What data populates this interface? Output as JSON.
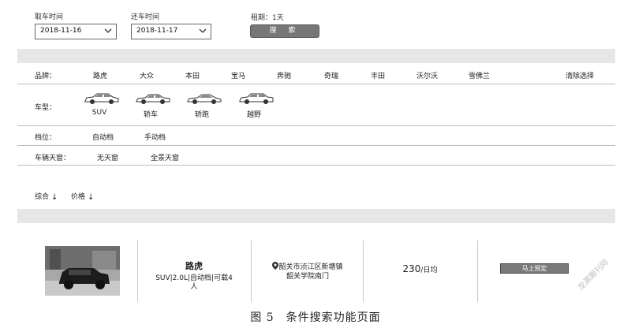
{
  "search": {
    "pickup_label": "取车时间",
    "pickup_value": "2018-11-16",
    "return_label": "还车时间",
    "return_value": "2018-11-17",
    "rental_period": "租期：1天",
    "search_button": "搜 索"
  },
  "filters": {
    "brand": {
      "label": "品牌：",
      "options": [
        "路虎",
        "大众",
        "本田",
        "宝马",
        "奔驰",
        "奇瑞",
        "丰田",
        "沃尔沃",
        "雪佛兰"
      ],
      "clear": "清除选择"
    },
    "car_type": {
      "label": "车型：",
      "options": [
        "SUV",
        "轿车",
        "轿跑",
        "越野"
      ]
    },
    "gear": {
      "label": "档位：",
      "options": [
        "自动档",
        "手动档"
      ]
    },
    "sunroof": {
      "label": "车辆天窗：",
      "options": [
        "无天窗",
        "全景天窗"
      ]
    }
  },
  "sort": {
    "overall": "综合",
    "price": "价格",
    "arrow_icon": "↓"
  },
  "result": {
    "name": "路虎",
    "spec_line1": "SUV|2.0L|自动档|可载4",
    "spec_line2": "人",
    "location_line1": "韶关市浈江区新塘镇",
    "location_line2": "韶关学院南门",
    "price": "230",
    "price_unit": "/日均",
    "book_button": "马上预定"
  },
  "caption": "图 5　条件搜索功能页面",
  "watermark": "龙源期刊网",
  "colors": {
    "band": "#e6e6e6",
    "button_bg": "#777777",
    "rule": "#bdbdbd"
  }
}
